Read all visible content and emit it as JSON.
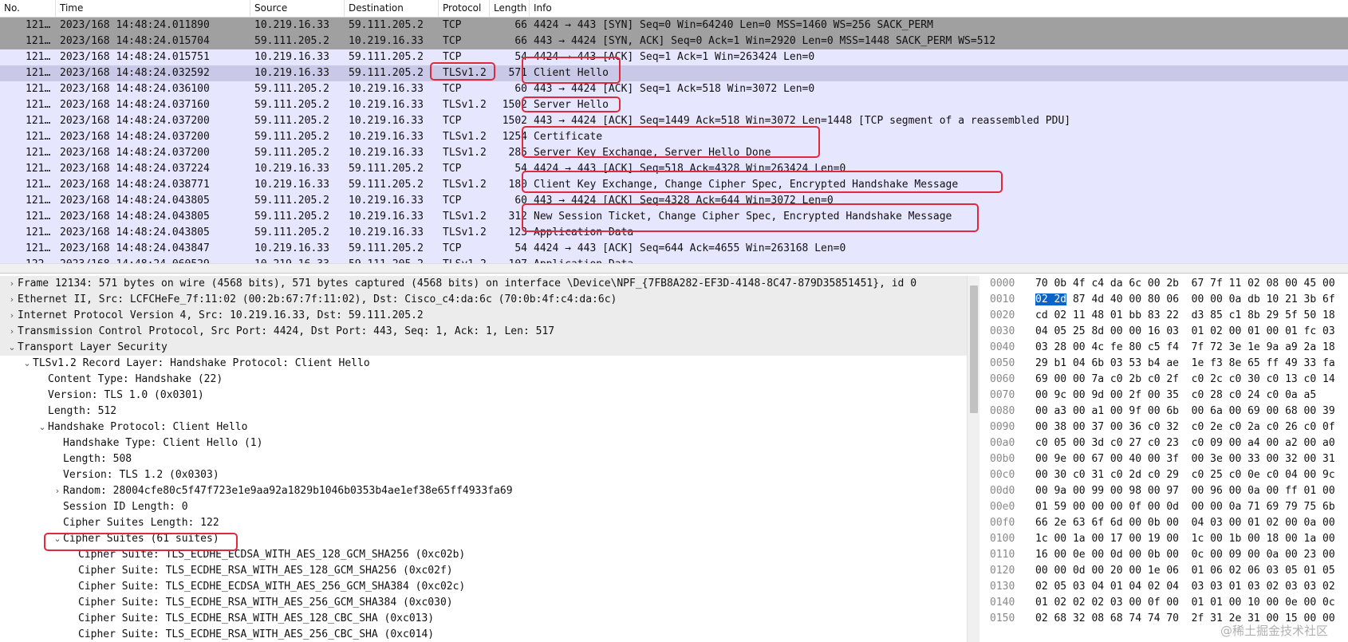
{
  "packet_list": {
    "columns": [
      "No.",
      "Time",
      "Source",
      "Destination",
      "Protocol",
      "Length",
      "Info"
    ],
    "rows": [
      {
        "no": "121…",
        "time": "2023/168 14:48:24.011890",
        "src": "10.219.16.33",
        "dst": "59.111.205.2",
        "proto": "TCP",
        "len": "66",
        "info": "4424 → 443 [SYN] Seq=0 Win=64240 Len=0 MSS=1460 WS=256 SACK_PERM"
      },
      {
        "no": "121…",
        "time": "2023/168 14:48:24.015704",
        "src": "59.111.205.2",
        "dst": "10.219.16.33",
        "proto": "TCP",
        "len": "66",
        "info": "443 → 4424 [SYN, ACK] Seq=0 Ack=1 Win=2920 Len=0 MSS=1448 SACK_PERM WS=512"
      },
      {
        "no": "121…",
        "time": "2023/168 14:48:24.015751",
        "src": "10.219.16.33",
        "dst": "59.111.205.2",
        "proto": "TCP",
        "len": "54",
        "info": "4424 → 443 [ACK] Seq=1 Ack=1 Win=263424 Len=0"
      },
      {
        "no": "121…",
        "time": "2023/168 14:48:24.032592",
        "src": "10.219.16.33",
        "dst": "59.111.205.2",
        "proto": "TLSv1.2",
        "len": "571",
        "info": "Client Hello"
      },
      {
        "no": "121…",
        "time": "2023/168 14:48:24.036100",
        "src": "59.111.205.2",
        "dst": "10.219.16.33",
        "proto": "TCP",
        "len": "60",
        "info": "443 → 4424 [ACK] Seq=1 Ack=518 Win=3072 Len=0"
      },
      {
        "no": "121…",
        "time": "2023/168 14:48:24.037160",
        "src": "59.111.205.2",
        "dst": "10.219.16.33",
        "proto": "TLSv1.2",
        "len": "1502",
        "info": "Server Hello"
      },
      {
        "no": "121…",
        "time": "2023/168 14:48:24.037200",
        "src": "59.111.205.2",
        "dst": "10.219.16.33",
        "proto": "TCP",
        "len": "1502",
        "info": "443 → 4424 [ACK] Seq=1449 Ack=518 Win=3072 Len=1448 [TCP segment of a reassembled PDU]"
      },
      {
        "no": "121…",
        "time": "2023/168 14:48:24.037200",
        "src": "59.111.205.2",
        "dst": "10.219.16.33",
        "proto": "TLSv1.2",
        "len": "1254",
        "info": "Certificate"
      },
      {
        "no": "121…",
        "time": "2023/168 14:48:24.037200",
        "src": "59.111.205.2",
        "dst": "10.219.16.33",
        "proto": "TLSv1.2",
        "len": "285",
        "info": "Server Key Exchange, Server Hello Done"
      },
      {
        "no": "121…",
        "time": "2023/168 14:48:24.037224",
        "src": "10.219.16.33",
        "dst": "59.111.205.2",
        "proto": "TCP",
        "len": "54",
        "info": "4424 → 443 [ACK] Seq=518 Ack=4328 Win=263424 Len=0"
      },
      {
        "no": "121…",
        "time": "2023/168 14:48:24.038771",
        "src": "10.219.16.33",
        "dst": "59.111.205.2",
        "proto": "TLSv1.2",
        "len": "180",
        "info": "Client Key Exchange, Change Cipher Spec, Encrypted Handshake Message"
      },
      {
        "no": "121…",
        "time": "2023/168 14:48:24.043805",
        "src": "59.111.205.2",
        "dst": "10.219.16.33",
        "proto": "TCP",
        "len": "60",
        "info": "443 → 4424 [ACK] Seq=4328 Ack=644 Win=3072 Len=0"
      },
      {
        "no": "121…",
        "time": "2023/168 14:48:24.043805",
        "src": "59.111.205.2",
        "dst": "10.219.16.33",
        "proto": "TLSv1.2",
        "len": "312",
        "info": "New Session Ticket, Change Cipher Spec, Encrypted Handshake Message"
      },
      {
        "no": "121…",
        "time": "2023/168 14:48:24.043805",
        "src": "59.111.205.2",
        "dst": "10.219.16.33",
        "proto": "TLSv1.2",
        "len": "123",
        "info": "Application Data"
      },
      {
        "no": "121…",
        "time": "2023/168 14:48:24.043847",
        "src": "10.219.16.33",
        "dst": "59.111.205.2",
        "proto": "TCP",
        "len": "54",
        "info": "4424 → 443 [ACK] Seq=644 Ack=4655 Win=263168 Len=0"
      },
      {
        "no": "122…",
        "time": "2023/168 14:48:24.060529",
        "src": "10.219.16.33",
        "dst": "59.111.205.2",
        "proto": "TLSv1.2",
        "len": "107",
        "info": "Application Data"
      }
    ]
  },
  "details": {
    "rows": [
      {
        "caret": "›",
        "text": "Frame 12134: 571 bytes on wire (4568 bits), 571 bytes captured (4568 bits) on interface \\Device\\NPF_{7FB8A282-EF3D-4148-8C47-879D35851451}, id 0"
      },
      {
        "caret": "›",
        "text": "Ethernet II, Src: LCFCHeFe_7f:11:02 (00:2b:67:7f:11:02), Dst: Cisco_c4:da:6c (70:0b:4f:c4:da:6c)"
      },
      {
        "caret": "›",
        "text": "Internet Protocol Version 4, Src: 10.219.16.33, Dst: 59.111.205.2"
      },
      {
        "caret": "›",
        "text": "Transmission Control Protocol, Src Port: 4424, Dst Port: 443, Seq: 1, Ack: 1, Len: 517"
      },
      {
        "caret": "⌄",
        "text": "Transport Layer Security"
      },
      {
        "caret": "⌄",
        "text": "TLSv1.2 Record Layer: Handshake Protocol: Client Hello"
      },
      {
        "caret": "",
        "text": "Content Type: Handshake (22)"
      },
      {
        "caret": "",
        "text": "Version: TLS 1.0 (0x0301)"
      },
      {
        "caret": "",
        "text": "Length: 512"
      },
      {
        "caret": "⌄",
        "text": "Handshake Protocol: Client Hello"
      },
      {
        "caret": "",
        "text": "Handshake Type: Client Hello (1)"
      },
      {
        "caret": "",
        "text": "Length: 508"
      },
      {
        "caret": "",
        "text": "Version: TLS 1.2 (0x0303)"
      },
      {
        "caret": "›",
        "text": "Random: 28004cfe80c5f47f723e1e9aa92a1829b1046b0353b4ae1ef38e65ff4933fa69"
      },
      {
        "caret": "",
        "text": "Session ID Length: 0"
      },
      {
        "caret": "",
        "text": "Cipher Suites Length: 122"
      },
      {
        "caret": "⌄",
        "text": "Cipher Suites (61 suites)"
      },
      {
        "caret": "",
        "text": "Cipher Suite: TLS_ECDHE_ECDSA_WITH_AES_128_GCM_SHA256 (0xc02b)"
      },
      {
        "caret": "",
        "text": "Cipher Suite: TLS_ECDHE_RSA_WITH_AES_128_GCM_SHA256 (0xc02f)"
      },
      {
        "caret": "",
        "text": "Cipher Suite: TLS_ECDHE_ECDSA_WITH_AES_256_GCM_SHA384 (0xc02c)"
      },
      {
        "caret": "",
        "text": "Cipher Suite: TLS_ECDHE_RSA_WITH_AES_256_GCM_SHA384 (0xc030)"
      },
      {
        "caret": "",
        "text": "Cipher Suite: TLS_ECDHE_RSA_WITH_AES_128_CBC_SHA (0xc013)"
      },
      {
        "caret": "",
        "text": "Cipher Suite: TLS_ECDHE_RSA_WITH_AES_256_CBC_SHA (0xc014)"
      }
    ]
  },
  "hex": {
    "rows": [
      {
        "off": "0000",
        "bytes": "70 0b 4f c4 da 6c 00 2b  67 7f 11 02 08 00 45 00"
      },
      {
        "off": "0010",
        "sel": "02 2d",
        "bytes": " 87 4d 40 00 80 06  00 00 0a db 10 21 3b 6f"
      },
      {
        "off": "0020",
        "bytes": "cd 02 11 48 01 bb 83 22  d3 85 c1 8b 29 5f 50 18"
      },
      {
        "off": "0030",
        "bytes": "04 05 25 8d 00 00 16 03  01 02 00 01 00 01 fc 03"
      },
      {
        "off": "0040",
        "bytes": "03 28 00 4c fe 80 c5 f4  7f 72 3e 1e 9a a9 2a 18"
      },
      {
        "off": "0050",
        "bytes": "29 b1 04 6b 03 53 b4 ae  1e f3 8e 65 ff 49 33 fa"
      },
      {
        "off": "0060",
        "bytes": "69 00 00 7a c0 2b c0 2f  c0 2c c0 30 c0 13 c0 14"
      },
      {
        "off": "0070",
        "bytes": "00 9c 00 9d 00 2f 00 35  c0 28 c0 24 c0 0a a5"
      },
      {
        "off": "0080",
        "bytes": "00 a3 00 a1 00 9f 00 6b  00 6a 00 69 00 68 00 39"
      },
      {
        "off": "0090",
        "bytes": "00 38 00 37 00 36 c0 32  c0 2e c0 2a c0 26 c0 0f"
      },
      {
        "off": "00a0",
        "bytes": "c0 05 00 3d c0 27 c0 23  c0 09 00 a4 00 a2 00 a0"
      },
      {
        "off": "00b0",
        "bytes": "00 9e 00 67 00 40 00 3f  00 3e 00 33 00 32 00 31"
      },
      {
        "off": "00c0",
        "bytes": "00 30 c0 31 c0 2d c0 29  c0 25 c0 0e c0 04 00 9c"
      },
      {
        "off": "00d0",
        "bytes": "00 9a 00 99 00 98 00 97  00 96 00 0a 00 ff 01 00"
      },
      {
        "off": "00e0",
        "bytes": "01 59 00 00 00 0f 00 0d  00 00 0a 71 69 79 75 6b"
      },
      {
        "off": "00f0",
        "bytes": "66 2e 63 6f 6d 00 0b 00  04 03 00 01 02 00 0a 00"
      },
      {
        "off": "0100",
        "bytes": "1c 00 1a 00 17 00 19 00  1c 00 1b 00 18 00 1a 00"
      },
      {
        "off": "0110",
        "bytes": "16 00 0e 00 0d 00 0b 00  0c 00 09 00 0a 00 23 00"
      },
      {
        "off": "0120",
        "bytes": "00 00 0d 00 20 00 1e 06  01 06 02 06 03 05 01 05"
      },
      {
        "off": "0130",
        "bytes": "02 05 03 04 01 04 02 04  03 03 01 03 02 03 03 02"
      },
      {
        "off": "0140",
        "bytes": "01 02 02 02 03 00 0f 00  01 01 00 10 00 0e 00 0c"
      },
      {
        "off": "0150",
        "bytes": "02 68 32 08 68 74 74 70  2f 31 2e 31 00 15 00 00"
      }
    ]
  },
  "watermark": "@稀土掘金技术社区",
  "colors": {
    "annotation": "#e0283e",
    "tls_row": "#e7e6ff",
    "selected_row": "#c9c8e6",
    "tcp_gray": "#a0a0a0",
    "hex_selection": "#0a64c8"
  }
}
